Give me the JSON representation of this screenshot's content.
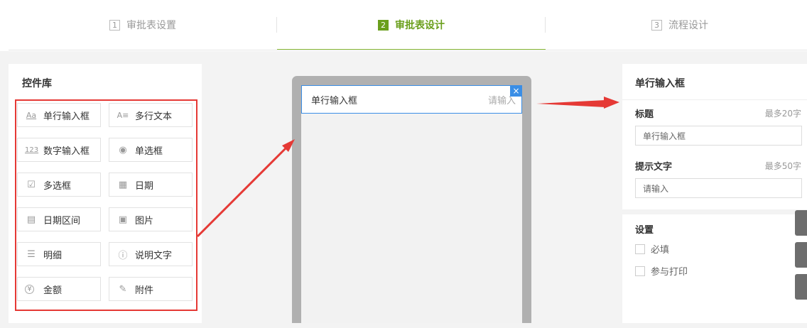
{
  "steps": [
    {
      "num": "1",
      "label": "审批表设置"
    },
    {
      "num": "2",
      "label": "审批表设计"
    },
    {
      "num": "3",
      "label": "流程设计"
    }
  ],
  "left_panel": {
    "title": "控件库",
    "controls": [
      {
        "icon": "Aa",
        "icon_name": "text-line-icon",
        "label": "单行输入框"
      },
      {
        "icon": "A≡",
        "icon_name": "text-multiline-icon",
        "label": "多行文本"
      },
      {
        "icon": "123",
        "icon_name": "number-icon",
        "label": "数字输入框"
      },
      {
        "icon": "◉",
        "icon_name": "radio-icon",
        "label": "单选框"
      },
      {
        "icon": "☑",
        "icon_name": "checkbox-icon",
        "label": "多选框"
      },
      {
        "icon": "▦",
        "icon_name": "calendar-icon",
        "label": "日期"
      },
      {
        "icon": "▤",
        "icon_name": "date-range-icon",
        "label": "日期区间"
      },
      {
        "icon": "▣",
        "icon_name": "image-icon",
        "label": "图片"
      },
      {
        "icon": "☰",
        "icon_name": "detail-list-icon",
        "label": "明细"
      },
      {
        "icon": "ⓘ",
        "icon_name": "info-icon",
        "label": "说明文字"
      },
      {
        "icon": "¥",
        "icon_name": "yen-icon",
        "label": "金额"
      },
      {
        "icon": "✎",
        "icon_name": "attachment-icon",
        "label": "附件"
      }
    ]
  },
  "preview": {
    "field_label": "单行输入框",
    "field_placeholder": "请输入",
    "close_glyph": "×"
  },
  "right_panel": {
    "title": "单行输入框",
    "title_field": {
      "label": "标题",
      "limit": "最多20字",
      "value": "单行输入框"
    },
    "hint_field": {
      "label": "提示文字",
      "limit": "最多50字",
      "value": "请输入"
    },
    "settings": {
      "label": "设置",
      "options": [
        "必填",
        "参与打印"
      ]
    }
  },
  "colors": {
    "accent_green": "#6a9f1c",
    "highlight_red": "#e53935",
    "select_blue": "#3a8ee6"
  }
}
